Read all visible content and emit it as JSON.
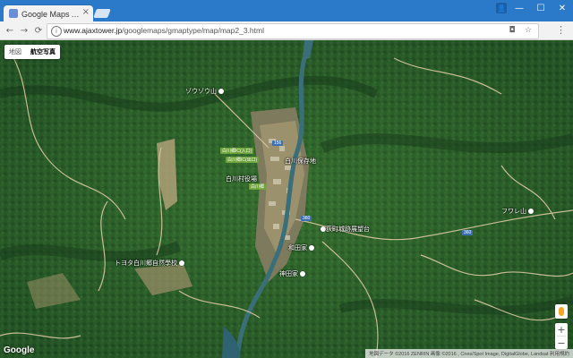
{
  "browser": {
    "tab_title": "Google Maps API サンプル",
    "tab_close": "×",
    "url_host": "www.ajaxtower.jp",
    "url_path": "/googlemaps/gmaptype/map/map2_3.html",
    "buttons": {
      "back": "←",
      "forward": "→",
      "reload": "⟳",
      "minimize": "—",
      "maximize": "☐",
      "close": "✕",
      "menu": "⋮"
    }
  },
  "map": {
    "maptype_map": "地図",
    "maptype_satellite": "航空写真",
    "active_type": "satellite",
    "zoom_in": "+",
    "zoom_out": "−",
    "logo": "Google",
    "attribution": "地図データ ©2016 ZENRIN 画像 ©2016 , Cnes/Spot Image, DigitalGlobe, Landsat    利用規約",
    "labels": {
      "sonoyama": "ゾウゾウ山",
      "shirakawa_office": "白川保存地",
      "shirakawa_village": "白川村役場",
      "observatory": "荻町城跡展望台",
      "wada": "和田家",
      "toyota_school": "トヨタ白川郷自然學校",
      "kanda": "神田家",
      "hakusan": "フワレ山"
    },
    "roadtags": {
      "tag1": "白川郷IC(入口)",
      "tag2": "白川郷IC(出口)",
      "tag3": "白川郷",
      "shield1": "156",
      "shield2": "360",
      "shield3": "360"
    }
  },
  "colors": {
    "chrome_blue": "#2b79c9",
    "forest_dark": "#1e4a22",
    "forest_mid": "#2f6a2c",
    "road": "#d8c7a0",
    "water": "#3a6f7a"
  }
}
